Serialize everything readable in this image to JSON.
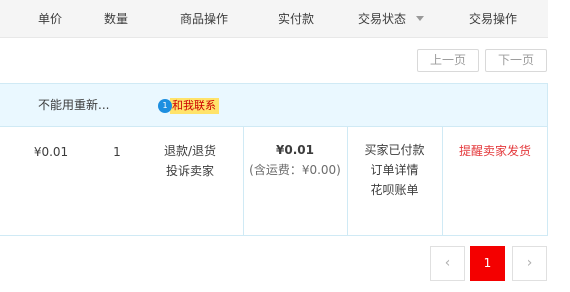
{
  "table_header": {
    "price": "单价",
    "quantity": "数量",
    "product_ops": "商品操作",
    "paid": "实付款",
    "status": "交易状态",
    "action": "交易操作"
  },
  "top_pager": {
    "prev": "上一页",
    "next": "下一页"
  },
  "order": {
    "shop_name": "不能用重新...",
    "contact_label": "和我联系",
    "contact_badge": "1",
    "price": "¥0.01",
    "quantity": "1",
    "product_ops": [
      "退款/退货",
      "投诉卖家"
    ],
    "paid_amount": "¥0.01",
    "paid_shipping": "(含运费：¥0.00)",
    "status_items": [
      "买家已付款",
      "订单详情",
      "花呗账单"
    ],
    "action": "提醒卖家发货"
  },
  "bottom_pager": {
    "prev_icon": "chevron-left",
    "current_page": "1",
    "next_icon": "chevron-right"
  },
  "colors": {
    "accent_red": "#f40000",
    "action_red": "#e4393c",
    "order_head_bg": "#eaf8ff",
    "contact_highlight": "#ffe36a",
    "wangwang_blue": "#1d8fe0"
  }
}
